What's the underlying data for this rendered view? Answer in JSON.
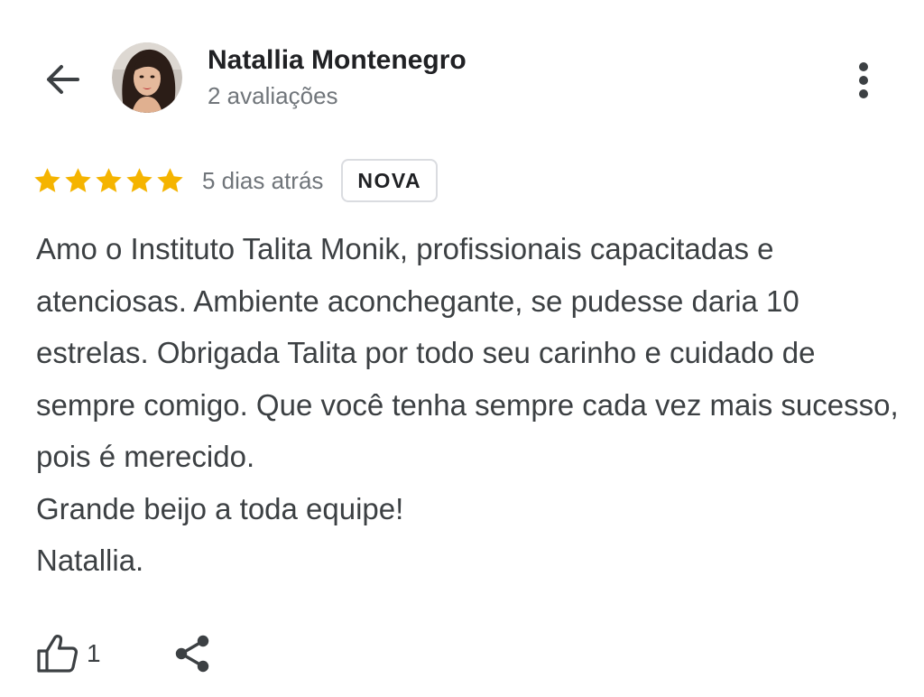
{
  "header": {
    "author_name": "Natallia Montenegro",
    "review_count": "2 avaliações",
    "back_icon": "arrow-left-icon",
    "more_icon": "more-vert-icon"
  },
  "review": {
    "rating": 5,
    "rating_max": 5,
    "date": "5 dias atrás",
    "badge": "NOVA",
    "paragraphs": [
      "Amo o Instituto Talita Monik, profissionais capacitadas e atenciosas. Ambiente aconchegante, se pudesse daria 10 estrelas. Obrigada Talita por todo seu carinho e cuidado de sempre comigo. Que você tenha sempre cada vez mais sucesso, pois é merecido.",
      "Grande beijo a toda equipe!",
      "Natallia."
    ]
  },
  "actions": {
    "like_count": "1",
    "like_icon": "thumbs-up-icon",
    "share_icon": "share-icon"
  },
  "colors": {
    "star": "#F5B400",
    "text_primary": "#202124",
    "text_body": "#3c4043",
    "text_secondary": "#70757a",
    "badge_border": "#dadce0"
  }
}
